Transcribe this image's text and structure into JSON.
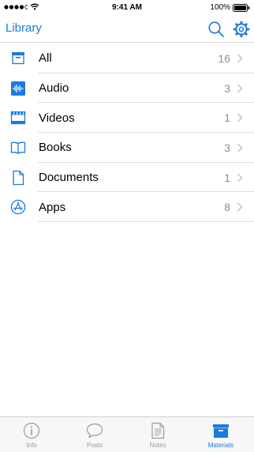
{
  "status": {
    "time": "9:41 AM",
    "battery": "100%"
  },
  "nav": {
    "title": "Library",
    "search_icon": "search-icon",
    "settings_icon": "gear-icon"
  },
  "items": [
    {
      "label": "All",
      "count": "16",
      "icon": "box-icon"
    },
    {
      "label": "Audio",
      "count": "3",
      "icon": "waveform-icon"
    },
    {
      "label": "Videos",
      "count": "1",
      "icon": "film-icon"
    },
    {
      "label": "Books",
      "count": "3",
      "icon": "book-icon"
    },
    {
      "label": "Documents",
      "count": "1",
      "icon": "document-icon"
    },
    {
      "label": "Apps",
      "count": "8",
      "icon": "app-store-icon"
    }
  ],
  "tabs": [
    {
      "label": "Info",
      "icon": "info-icon"
    },
    {
      "label": "Posts",
      "icon": "speech-bubble-icon"
    },
    {
      "label": "Notes",
      "icon": "notes-icon"
    },
    {
      "label": "Materials",
      "icon": "box-icon",
      "active": true
    }
  ],
  "colors": {
    "accent": "#1a7bdc",
    "secondary_text": "#8e8e93",
    "separator": "#e0e0e2"
  }
}
